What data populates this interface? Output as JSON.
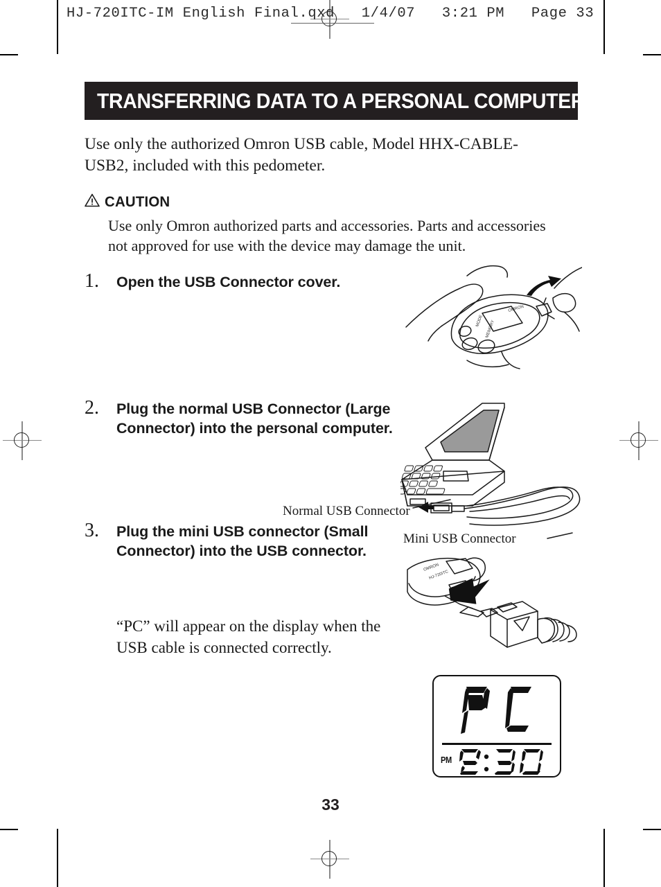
{
  "file_header": {
    "text": "HJ-720ITC-IM English Final.qxd   1/4/07   3:21 PM   Page 33"
  },
  "banner": {
    "title": "TRANSFERRING DATA TO A PERSONAL COMPUTER",
    "background_color": "#231f20",
    "text_color": "#ffffff"
  },
  "intro": {
    "text": "Use only the authorized Omron USB cable, Model HHX-CABLE-USB2, included with this pedometer."
  },
  "caution": {
    "label": "CAUTION",
    "icon": "warning-triangle-icon",
    "body": "Use only Omron authorized parts and accessories. Parts and accessories not approved for use with the device may damage the unit."
  },
  "steps": [
    {
      "number": "1.",
      "text": "Open the USB Connector cover.",
      "illustration": "hand-holding-pedometer-opening-usb-cover"
    },
    {
      "number": "2.",
      "text": "Plug the normal USB Connector (Large Connector) into the personal computer.",
      "illustration": "laptop-with-usb-cable"
    },
    {
      "number": "3.",
      "text": "Plug the mini USB connector (Small Connector) into the USB connector.",
      "illustration": "mini-usb-plugging-into-pedometer"
    }
  ],
  "callouts": {
    "normal_usb": "Normal USB Connector",
    "mini_usb": "Mini USB Connector"
  },
  "pc_note": {
    "text": "“PC” will appear on the display when the USB cable is connected correctly."
  },
  "lcd": {
    "main_text": "PC",
    "segment_left": "P",
    "segment_right": "C",
    "meridiem": "PM",
    "time": "2:30"
  },
  "page_number": "33"
}
